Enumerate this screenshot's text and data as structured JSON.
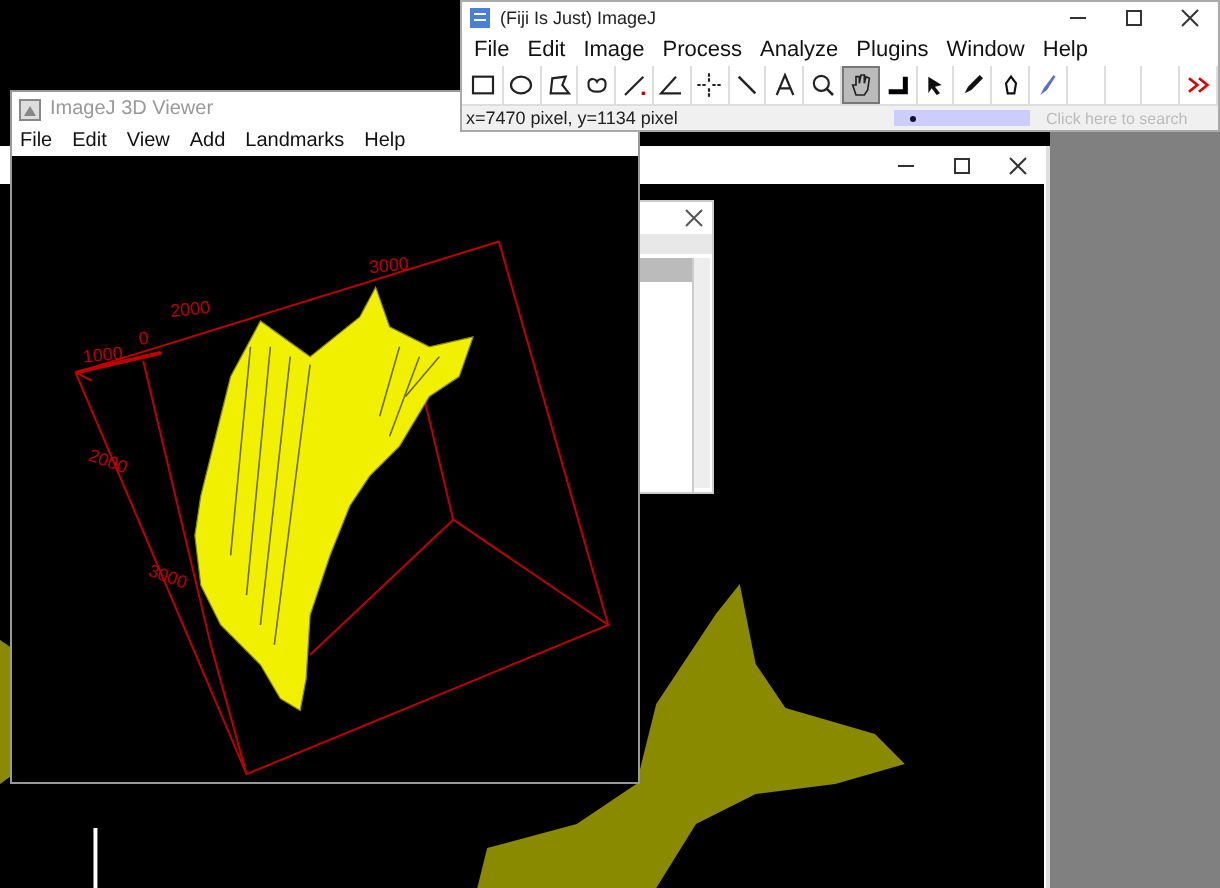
{
  "fiji_window": {
    "title": "(Fiji Is Just) ImageJ",
    "menu": [
      "File",
      "Edit",
      "Image",
      "Process",
      "Analyze",
      "Plugins",
      "Window",
      "Help"
    ],
    "tools": [
      {
        "selected": false
      },
      {
        "selected": false
      },
      {
        "selected": false
      },
      {
        "selected": false
      },
      {
        "selected": false
      },
      {
        "selected": false
      },
      {
        "selected": false
      },
      {
        "selected": false
      },
      {
        "selected": false
      },
      {
        "selected": false
      },
      {
        "selected": true
      },
      {
        "selected": false
      },
      {
        "selected": false
      },
      {
        "selected": false
      },
      {
        "selected": false
      },
      {
        "selected": false
      },
      {
        "selected": false
      },
      {
        "selected": false
      },
      {
        "selected": false
      },
      {
        "selected": false
      }
    ],
    "status": "x=7470 pixel, y=1134 pixel",
    "search": {
      "placeholder": "Click here to search"
    }
  },
  "viewer_window": {
    "title": "ImageJ 3D Viewer",
    "menu": [
      "File",
      "Edit",
      "View",
      "Add",
      "Landmarks",
      "Help"
    ],
    "axis_labels": [
      "3000",
      "2000",
      "1000",
      "0",
      "2000",
      "3000"
    ]
  }
}
